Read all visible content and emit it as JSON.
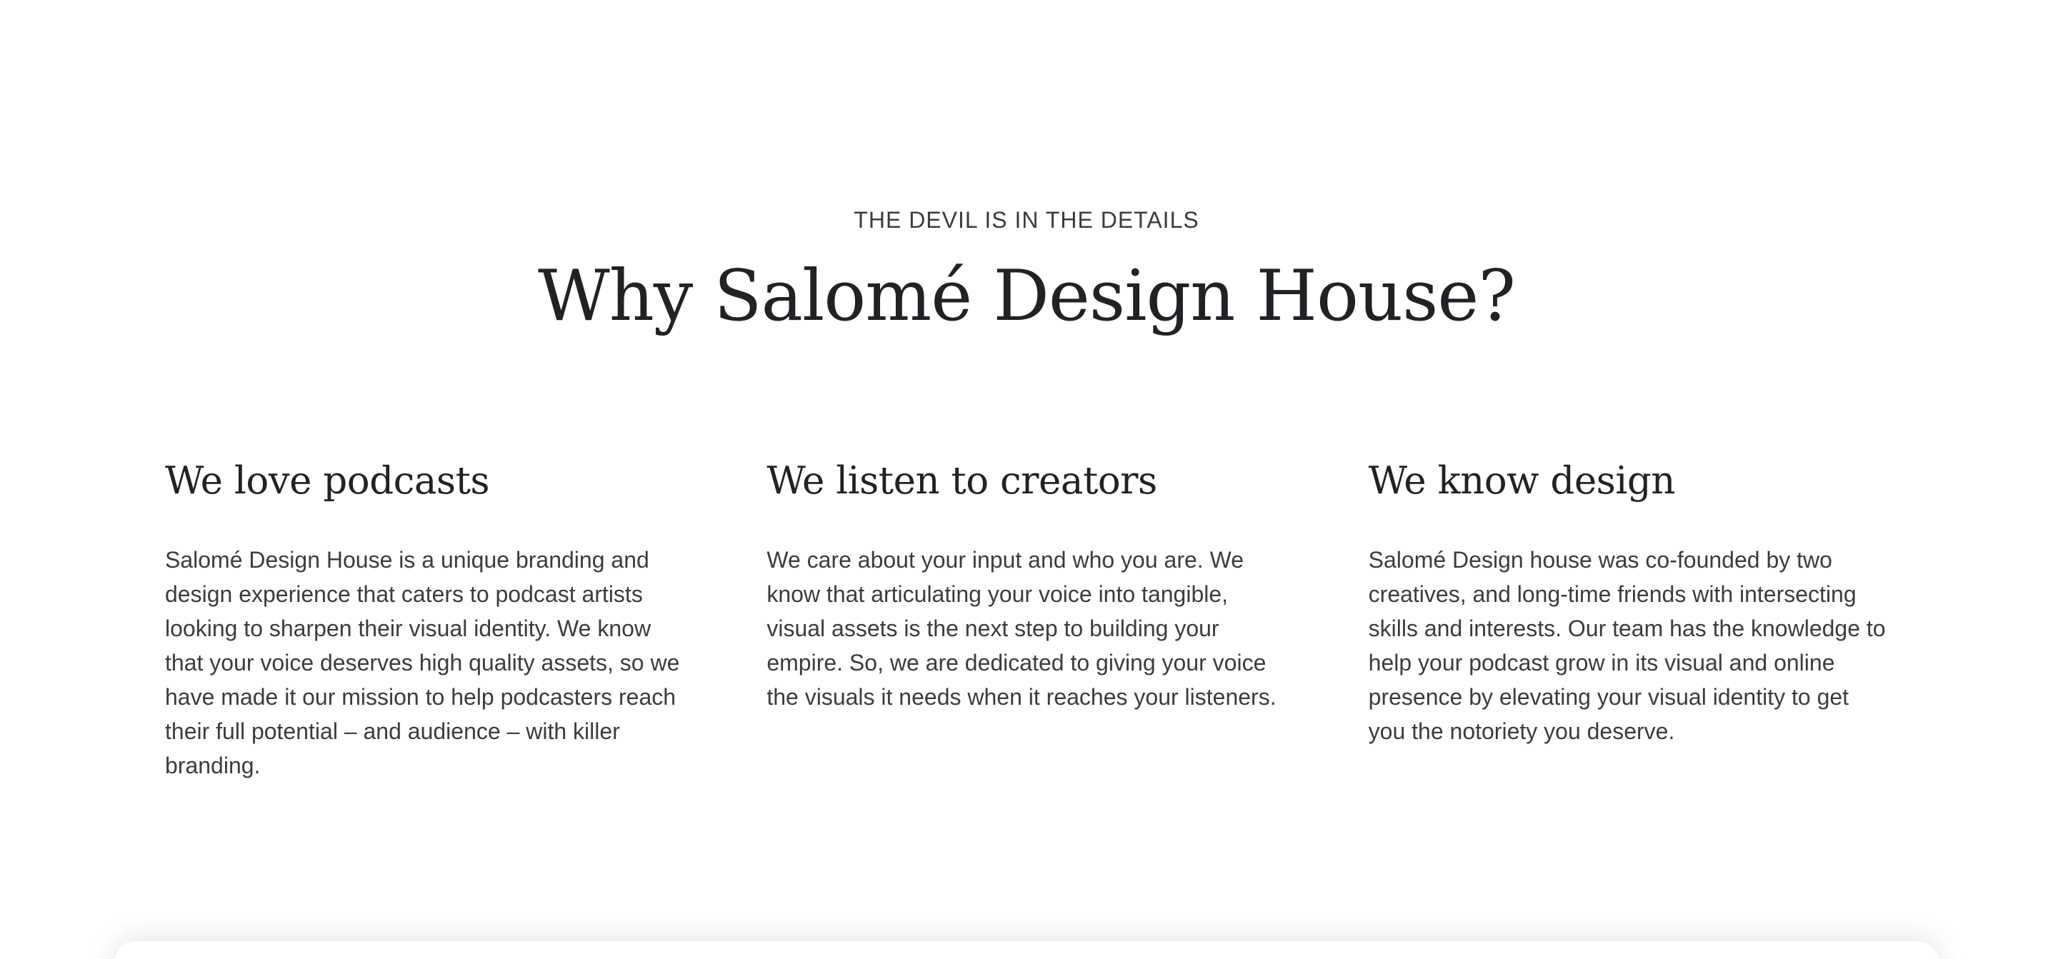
{
  "section": {
    "eyebrow": "THE DEVIL IS IN THE DETAILS",
    "title": "Why Salomé Design House?"
  },
  "features": [
    {
      "title": "We love podcasts",
      "body": "Salomé Design House is a unique branding and design experience that caters to podcast artists looking to sharpen their visual identity. We know that your voice deserves high quality assets, so we have made it our mission to help podcasters reach their full potential – and audience – with killer branding."
    },
    {
      "title": "We listen to creators",
      "body": "We care about your input and who you are. We know that articulating your voice into tangible, visual assets is the next step to building your empire. So, we are dedicated to giving your voice the visuals it needs when it reaches your listeners."
    },
    {
      "title": "We know design",
      "body": "Salomé Design house was co-founded by two creatives, and long-time friends with intersecting skills and interests. Our team has the knowledge to help your podcast grow in its visual and online presence by elevating your visual identity to get you the notoriety you deserve."
    }
  ],
  "colors": {
    "background": "#ffffff",
    "heading": "#202226",
    "body": "#3a3c40"
  }
}
